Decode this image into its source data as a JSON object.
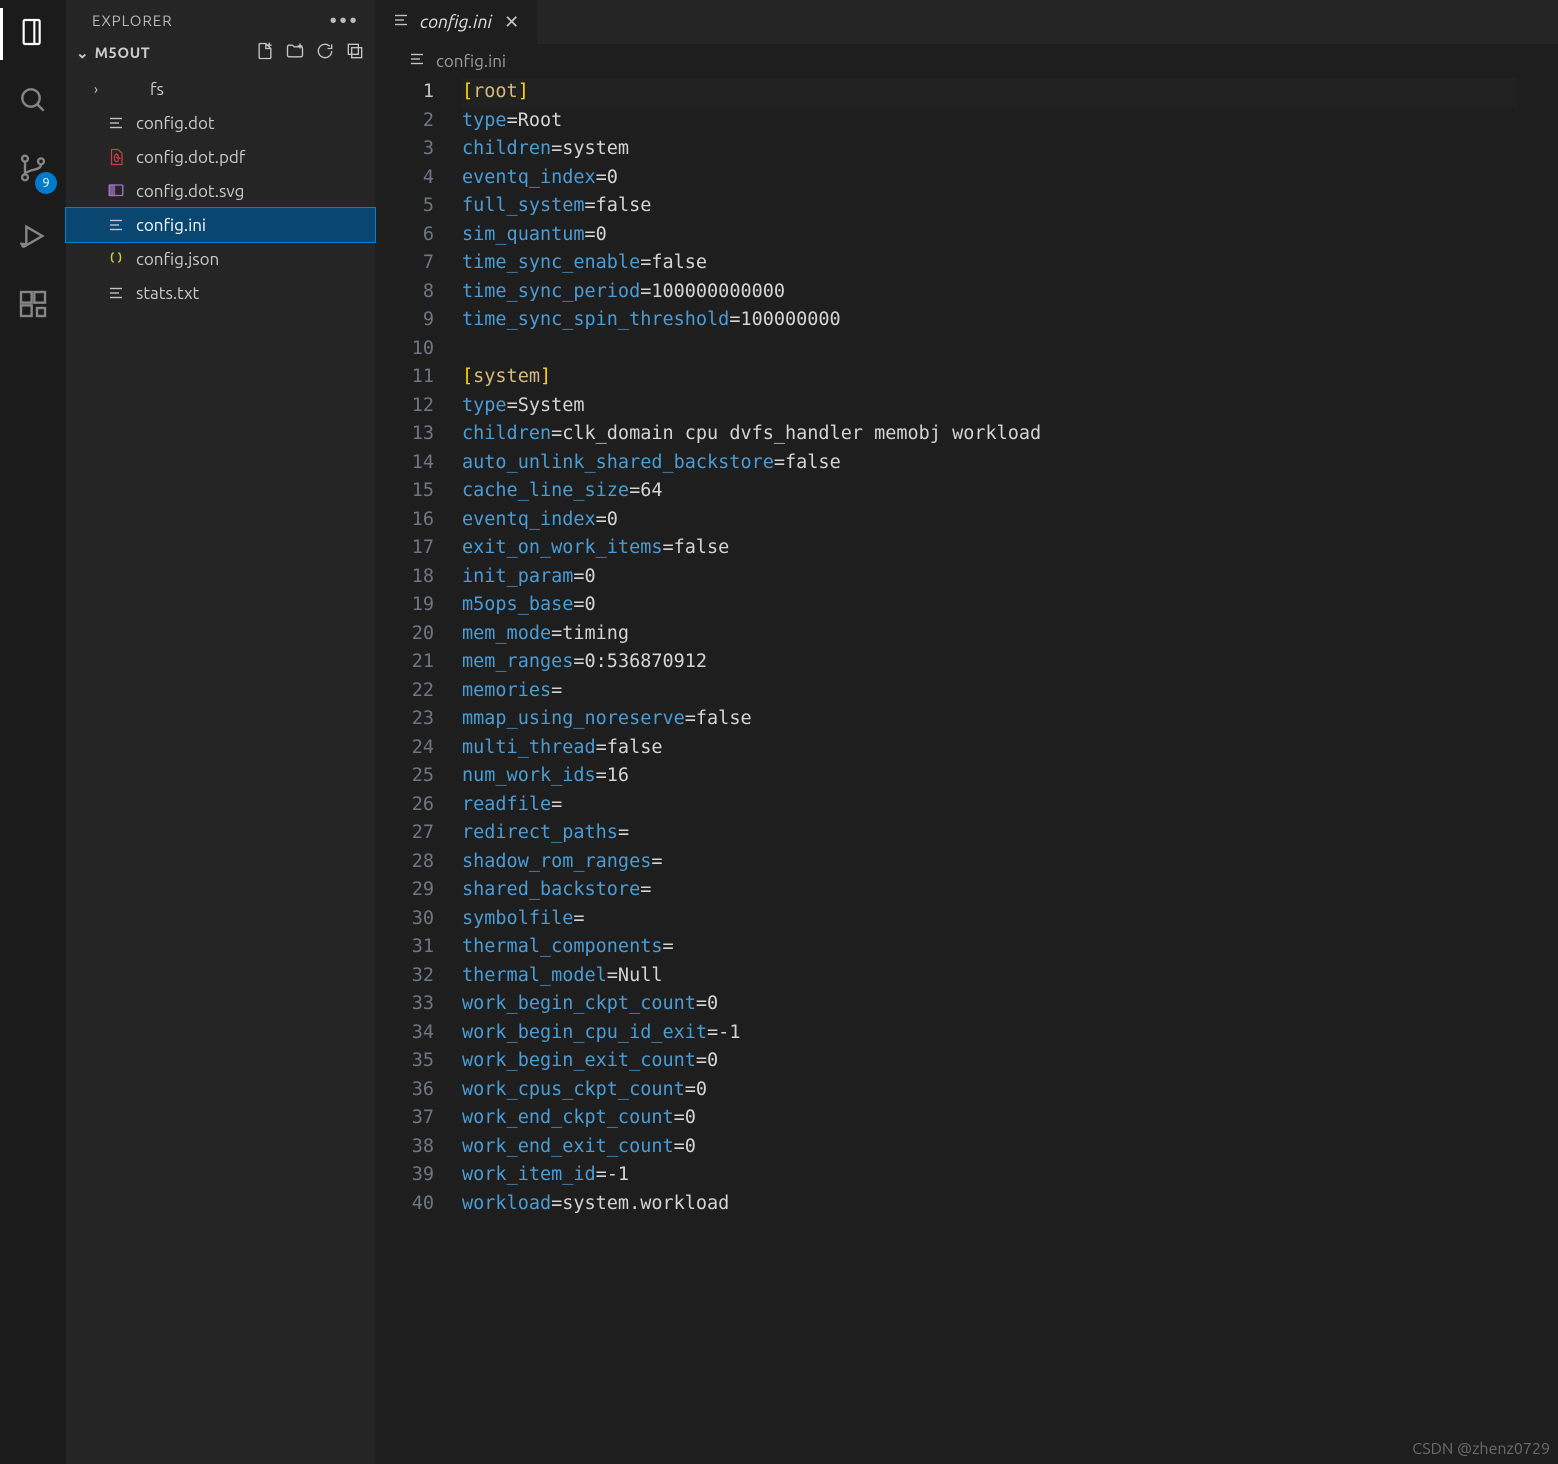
{
  "activity": {
    "scm_badge": "9"
  },
  "sidebar": {
    "title": "EXPLORER",
    "folder": "M5OUT",
    "items": [
      {
        "label": "fs",
        "kind": "folder"
      },
      {
        "label": "config.dot",
        "kind": "file-text"
      },
      {
        "label": "config.dot.pdf",
        "kind": "file-pdf"
      },
      {
        "label": "config.dot.svg",
        "kind": "file-svg"
      },
      {
        "label": "config.ini",
        "kind": "file-text",
        "selected": true
      },
      {
        "label": "config.json",
        "kind": "file-json"
      },
      {
        "label": "stats.txt",
        "kind": "file-text"
      }
    ]
  },
  "tab": {
    "label": "config.ini"
  },
  "breadcrumb": {
    "label": "config.ini"
  },
  "code_lines": [
    {
      "n": 1,
      "tokens": [
        {
          "t": "[",
          "c": "br"
        },
        {
          "t": "root",
          "c": "hdr"
        },
        {
          "t": "]",
          "c": "br"
        }
      ],
      "current": true
    },
    {
      "n": 2,
      "tokens": [
        {
          "t": "type",
          "c": "key"
        },
        {
          "t": "=Root",
          "c": "def"
        }
      ]
    },
    {
      "n": 3,
      "tokens": [
        {
          "t": "children",
          "c": "key"
        },
        {
          "t": "=system",
          "c": "def"
        }
      ]
    },
    {
      "n": 4,
      "tokens": [
        {
          "t": "eventq_index",
          "c": "key"
        },
        {
          "t": "=0",
          "c": "def"
        }
      ]
    },
    {
      "n": 5,
      "tokens": [
        {
          "t": "full_system",
          "c": "key"
        },
        {
          "t": "=false",
          "c": "def"
        }
      ]
    },
    {
      "n": 6,
      "tokens": [
        {
          "t": "sim_quantum",
          "c": "key"
        },
        {
          "t": "=0",
          "c": "def"
        }
      ]
    },
    {
      "n": 7,
      "tokens": [
        {
          "t": "time_sync_enable",
          "c": "key"
        },
        {
          "t": "=false",
          "c": "def"
        }
      ]
    },
    {
      "n": 8,
      "tokens": [
        {
          "t": "time_sync_period",
          "c": "key"
        },
        {
          "t": "=100000000000",
          "c": "def"
        }
      ]
    },
    {
      "n": 9,
      "tokens": [
        {
          "t": "time_sync_spin_threshold",
          "c": "key"
        },
        {
          "t": "=100000000",
          "c": "def"
        }
      ]
    },
    {
      "n": 10,
      "tokens": []
    },
    {
      "n": 11,
      "tokens": [
        {
          "t": "[",
          "c": "br"
        },
        {
          "t": "system",
          "c": "hdr"
        },
        {
          "t": "]",
          "c": "br"
        }
      ]
    },
    {
      "n": 12,
      "tokens": [
        {
          "t": "type",
          "c": "key"
        },
        {
          "t": "=System",
          "c": "def"
        }
      ]
    },
    {
      "n": 13,
      "tokens": [
        {
          "t": "children",
          "c": "key"
        },
        {
          "t": "=clk_domain cpu dvfs_handler memobj workload",
          "c": "def"
        }
      ]
    },
    {
      "n": 14,
      "tokens": [
        {
          "t": "auto_unlink_shared_backstore",
          "c": "key"
        },
        {
          "t": "=false",
          "c": "def"
        }
      ]
    },
    {
      "n": 15,
      "tokens": [
        {
          "t": "cache_line_size",
          "c": "key"
        },
        {
          "t": "=64",
          "c": "def"
        }
      ]
    },
    {
      "n": 16,
      "tokens": [
        {
          "t": "eventq_index",
          "c": "key"
        },
        {
          "t": "=0",
          "c": "def"
        }
      ]
    },
    {
      "n": 17,
      "tokens": [
        {
          "t": "exit_on_work_items",
          "c": "key"
        },
        {
          "t": "=false",
          "c": "def"
        }
      ]
    },
    {
      "n": 18,
      "tokens": [
        {
          "t": "init_param",
          "c": "key"
        },
        {
          "t": "=0",
          "c": "def"
        }
      ]
    },
    {
      "n": 19,
      "tokens": [
        {
          "t": "m5ops_base",
          "c": "key"
        },
        {
          "t": "=0",
          "c": "def"
        }
      ]
    },
    {
      "n": 20,
      "tokens": [
        {
          "t": "mem_mode",
          "c": "key"
        },
        {
          "t": "=timing",
          "c": "def"
        }
      ]
    },
    {
      "n": 21,
      "tokens": [
        {
          "t": "mem_ranges",
          "c": "key"
        },
        {
          "t": "=0:536870912",
          "c": "def"
        }
      ]
    },
    {
      "n": 22,
      "tokens": [
        {
          "t": "memories",
          "c": "key"
        },
        {
          "t": "=",
          "c": "def"
        }
      ]
    },
    {
      "n": 23,
      "tokens": [
        {
          "t": "mmap_using_noreserve",
          "c": "key"
        },
        {
          "t": "=false",
          "c": "def"
        }
      ]
    },
    {
      "n": 24,
      "tokens": [
        {
          "t": "multi_thread",
          "c": "key"
        },
        {
          "t": "=false",
          "c": "def"
        }
      ]
    },
    {
      "n": 25,
      "tokens": [
        {
          "t": "num_work_ids",
          "c": "key"
        },
        {
          "t": "=16",
          "c": "def"
        }
      ]
    },
    {
      "n": 26,
      "tokens": [
        {
          "t": "readfile",
          "c": "key"
        },
        {
          "t": "=",
          "c": "def"
        }
      ]
    },
    {
      "n": 27,
      "tokens": [
        {
          "t": "redirect_paths",
          "c": "key"
        },
        {
          "t": "=",
          "c": "def"
        }
      ]
    },
    {
      "n": 28,
      "tokens": [
        {
          "t": "shadow_rom_ranges",
          "c": "key"
        },
        {
          "t": "=",
          "c": "def"
        }
      ]
    },
    {
      "n": 29,
      "tokens": [
        {
          "t": "shared_backstore",
          "c": "key"
        },
        {
          "t": "=",
          "c": "def"
        }
      ]
    },
    {
      "n": 30,
      "tokens": [
        {
          "t": "symbolfile",
          "c": "key"
        },
        {
          "t": "=",
          "c": "def"
        }
      ]
    },
    {
      "n": 31,
      "tokens": [
        {
          "t": "thermal_components",
          "c": "key"
        },
        {
          "t": "=",
          "c": "def"
        }
      ]
    },
    {
      "n": 32,
      "tokens": [
        {
          "t": "thermal_model",
          "c": "key"
        },
        {
          "t": "=Null",
          "c": "def"
        }
      ]
    },
    {
      "n": 33,
      "tokens": [
        {
          "t": "work_begin_ckpt_count",
          "c": "key"
        },
        {
          "t": "=0",
          "c": "def"
        }
      ]
    },
    {
      "n": 34,
      "tokens": [
        {
          "t": "work_begin_cpu_id_exit",
          "c": "key"
        },
        {
          "t": "=-1",
          "c": "def"
        }
      ]
    },
    {
      "n": 35,
      "tokens": [
        {
          "t": "work_begin_exit_count",
          "c": "key"
        },
        {
          "t": "=0",
          "c": "def"
        }
      ]
    },
    {
      "n": 36,
      "tokens": [
        {
          "t": "work_cpus_ckpt_count",
          "c": "key"
        },
        {
          "t": "=0",
          "c": "def"
        }
      ]
    },
    {
      "n": 37,
      "tokens": [
        {
          "t": "work_end_ckpt_count",
          "c": "key"
        },
        {
          "t": "=0",
          "c": "def"
        }
      ]
    },
    {
      "n": 38,
      "tokens": [
        {
          "t": "work_end_exit_count",
          "c": "key"
        },
        {
          "t": "=0",
          "c": "def"
        }
      ]
    },
    {
      "n": 39,
      "tokens": [
        {
          "t": "work_item_id",
          "c": "key"
        },
        {
          "t": "=-1",
          "c": "def"
        }
      ]
    },
    {
      "n": 40,
      "tokens": [
        {
          "t": "workload",
          "c": "key"
        },
        {
          "t": "=system.workload",
          "c": "def"
        }
      ]
    }
  ],
  "watermark": "CSDN @zhenz0729"
}
